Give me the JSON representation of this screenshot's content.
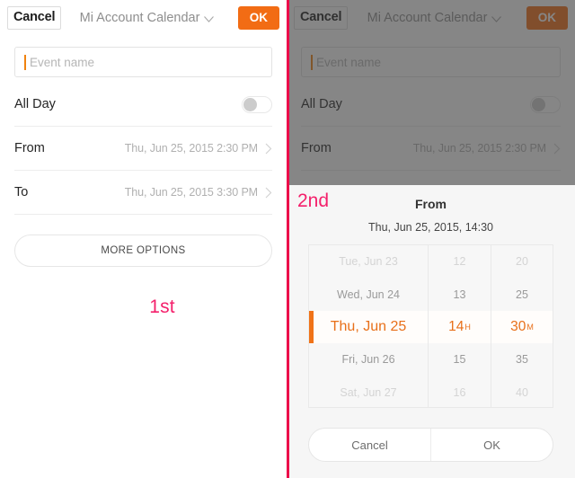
{
  "app": {
    "topbar": {
      "cancel_label": "Cancel",
      "title": "Mi Account Calendar",
      "dropdown_icon": "chevron-down-icon",
      "ok_label": "OK",
      "ok_color": "#f26c14"
    },
    "form": {
      "event_name_placeholder": "Event name",
      "all_day_label": "All Day",
      "all_day_on": false,
      "from_label": "From",
      "from_value": "Thu, Jun 25, 2015 2:30 PM",
      "to_label": "To",
      "to_value": "Thu, Jun 25, 2015 3:30 PM",
      "more_options_label": "MORE OPTIONS",
      "chevron_icon": "chevron-right-icon"
    }
  },
  "annotations": {
    "step1": "1st",
    "step2": "2nd",
    "color": "#f4206b"
  },
  "picker": {
    "title": "From",
    "subtitle": "Thu, Jun 25, 2015, 14:30",
    "accent_color": "#e8701a",
    "date_column": [
      "Tue, Jun 23",
      "Wed, Jun 24",
      "Thu, Jun 25",
      "Fri, Jun 26",
      "Sat, Jun 27"
    ],
    "hour_column": [
      "12",
      "13",
      "14",
      "15",
      "16"
    ],
    "minute_column": [
      "20",
      "25",
      "30",
      "35",
      "40"
    ],
    "selected_index": 2,
    "selected_date": "Thu, Jun 25",
    "selected_hour": "14",
    "selected_minute": "30",
    "hour_unit": "H",
    "minute_unit": "M",
    "cancel_label": "Cancel",
    "ok_label": "OK"
  }
}
